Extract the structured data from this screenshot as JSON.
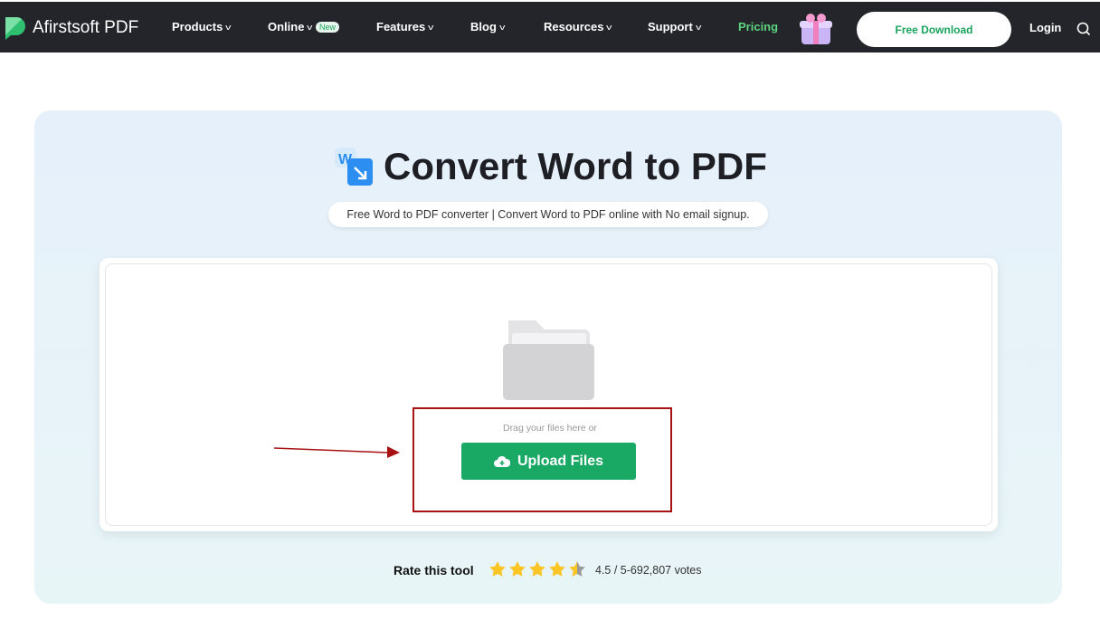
{
  "nav": {
    "brand": "Afirstsoft PDF",
    "items": [
      {
        "label": "Products",
        "chevron": true
      },
      {
        "label": "Online",
        "chevron": true,
        "badge": "New"
      },
      {
        "label": "Features",
        "chevron": true
      },
      {
        "label": "Blog",
        "chevron": true
      },
      {
        "label": "Resources",
        "chevron": true
      },
      {
        "label": "Support",
        "chevron": true
      },
      {
        "label": "Pricing"
      }
    ],
    "download": "Free Download",
    "login": "Login"
  },
  "hero": {
    "title": "Convert Word to PDF",
    "subtitle": "Free Word to PDF converter | Convert Word to PDF online with No email signup.",
    "drag_text": "Drag your files here or",
    "upload_label": "Upload Files"
  },
  "rating": {
    "label": "Rate this tool",
    "value": 4.5,
    "max": 5,
    "text": "4.5 / 5-692,807 votes"
  },
  "colors": {
    "accent": "#1aa865",
    "nav_bg": "#23252b",
    "pricing": "#5ed37f",
    "annotation": "#a81212"
  }
}
